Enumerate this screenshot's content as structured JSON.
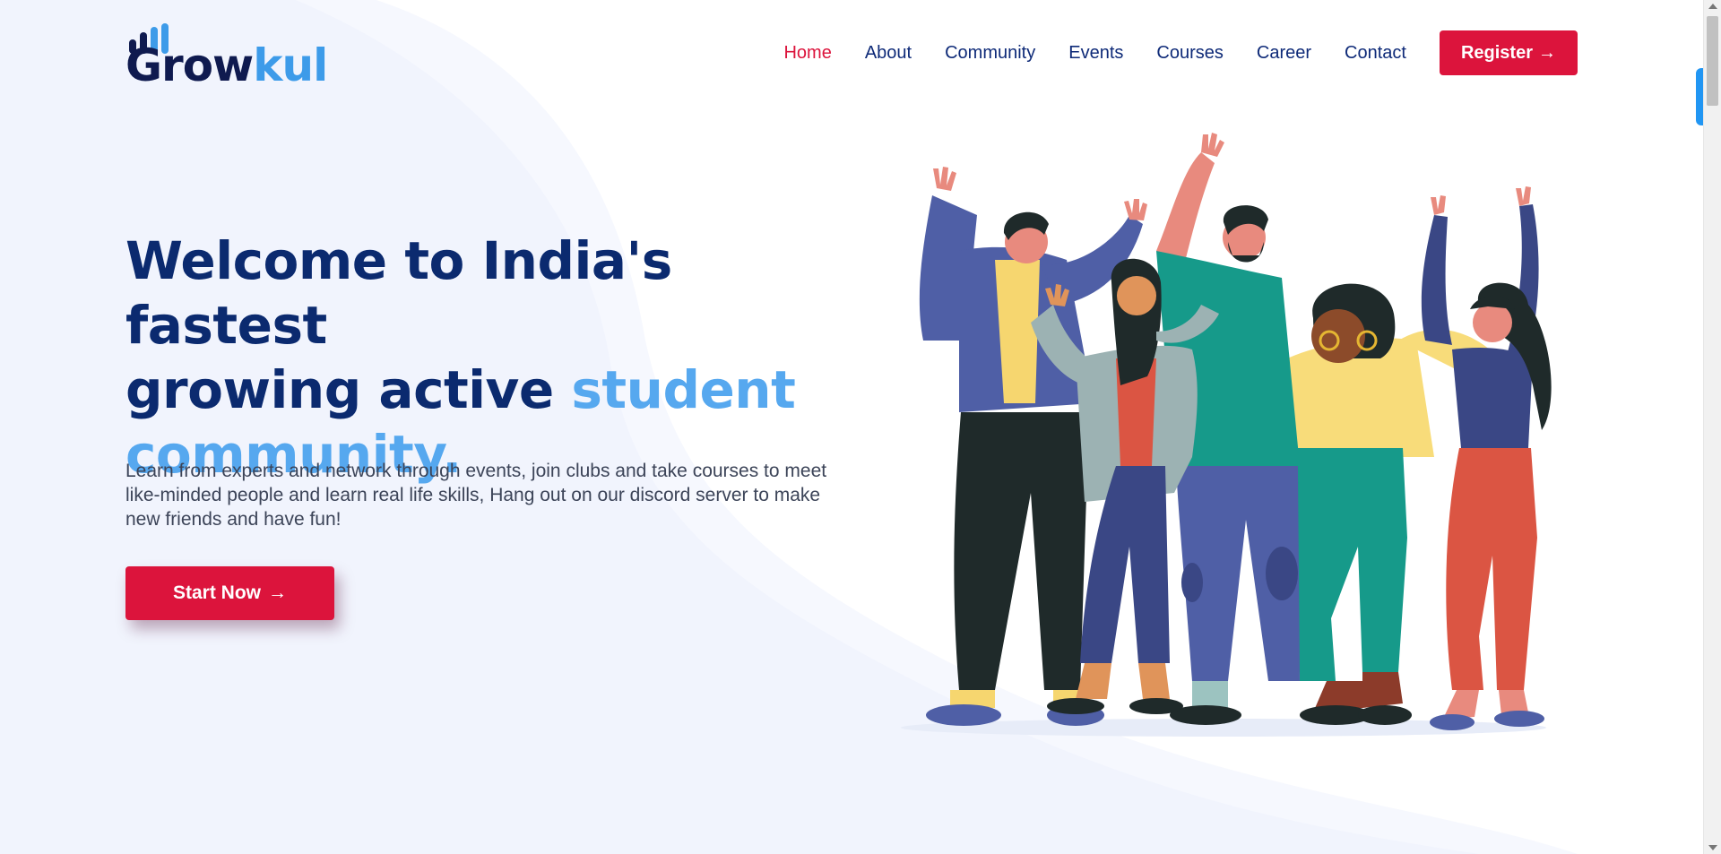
{
  "brand": {
    "logo_part1": "Grow",
    "logo_part2": "kul",
    "dark_color": "#0f1a4f",
    "light_color": "#3d9be9"
  },
  "nav": {
    "items": [
      {
        "label": "Home",
        "active": true
      },
      {
        "label": "About",
        "active": false
      },
      {
        "label": "Community",
        "active": false
      },
      {
        "label": "Events",
        "active": false
      },
      {
        "label": "Courses",
        "active": false
      },
      {
        "label": "Career",
        "active": false
      },
      {
        "label": "Contact",
        "active": false
      }
    ],
    "register_label": "Register",
    "register_icon": "arrow-right-icon"
  },
  "hero": {
    "title_line1": "Welcome to India's fastest",
    "title_line2_plain": "growing active ",
    "title_line2_accent": "student",
    "title_line3_accent": "community.",
    "description": "Learn from experts and network through events, join clubs and take courses to meet like-minded people and learn real life skills, Hang out on our discord server to make new friends and have fun!",
    "cta_label": "Start Now",
    "cta_icon": "arrow-right-icon"
  },
  "colors": {
    "primary": "#dc143c",
    "heading": "#0b2a6f",
    "accent": "#56a8ef",
    "nav_text": "#0e2a78",
    "background_wave": "#f1f4fd"
  }
}
